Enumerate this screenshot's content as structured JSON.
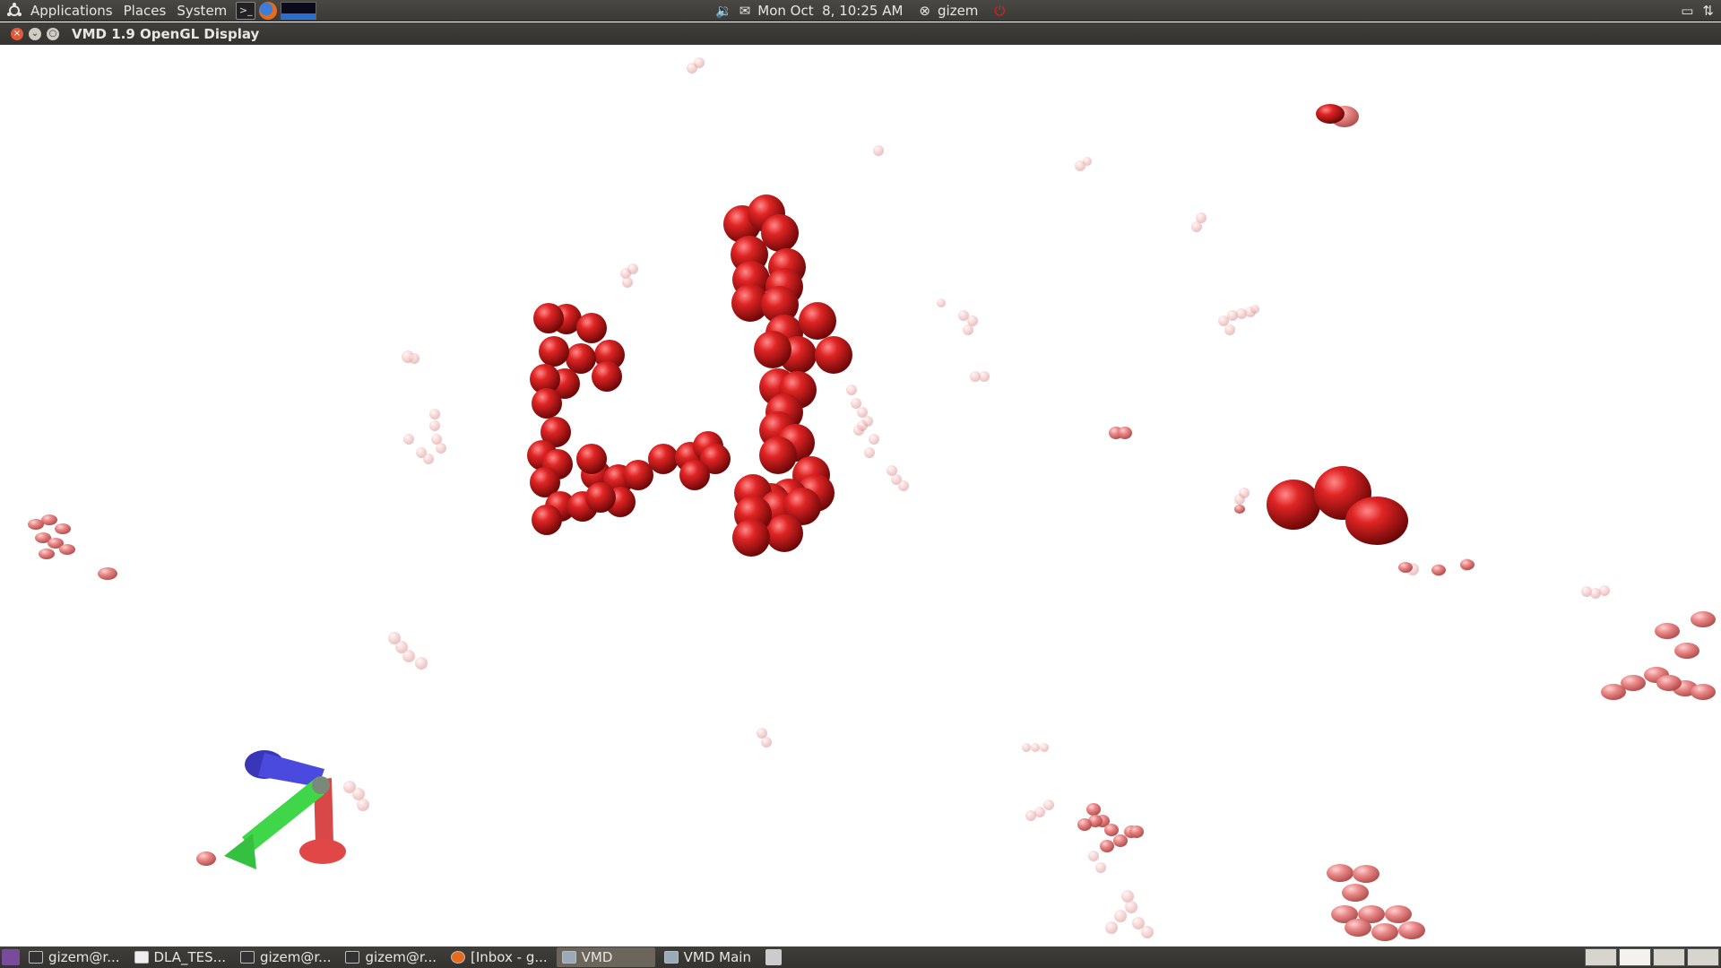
{
  "top_panel": {
    "menus": [
      "Applications",
      "Places",
      "System"
    ],
    "launchers": [
      "terminal-icon",
      "firefox-icon",
      "system-monitor-icon"
    ],
    "clock": "Mon Oct  8, 10:25 AM",
    "user": "gizem",
    "indicators": [
      "volume-icon",
      "mail-icon",
      "user-status-icon",
      "power-icon"
    ],
    "right_icons": [
      "display-icon",
      "network-icon"
    ]
  },
  "window": {
    "title": "VMD 1.9 OpenGL Display",
    "buttons": [
      "close-icon",
      "minimize-icon",
      "maximize-icon"
    ]
  },
  "scene": {
    "background": "#ffffff",
    "bead_color": "#cc1e1e",
    "axes_colors": {
      "x": "#e04848",
      "y": "#3fd64a",
      "z": "#4a4adf"
    }
  },
  "taskbar": {
    "tasks": [
      "gizem@r...",
      "DLA_TES...",
      "gizem@r...",
      "gizem@r...",
      "[Inbox - g...",
      "VMD",
      "VMD Main"
    ],
    "active_task": "VMD",
    "workspace_count": 4
  }
}
